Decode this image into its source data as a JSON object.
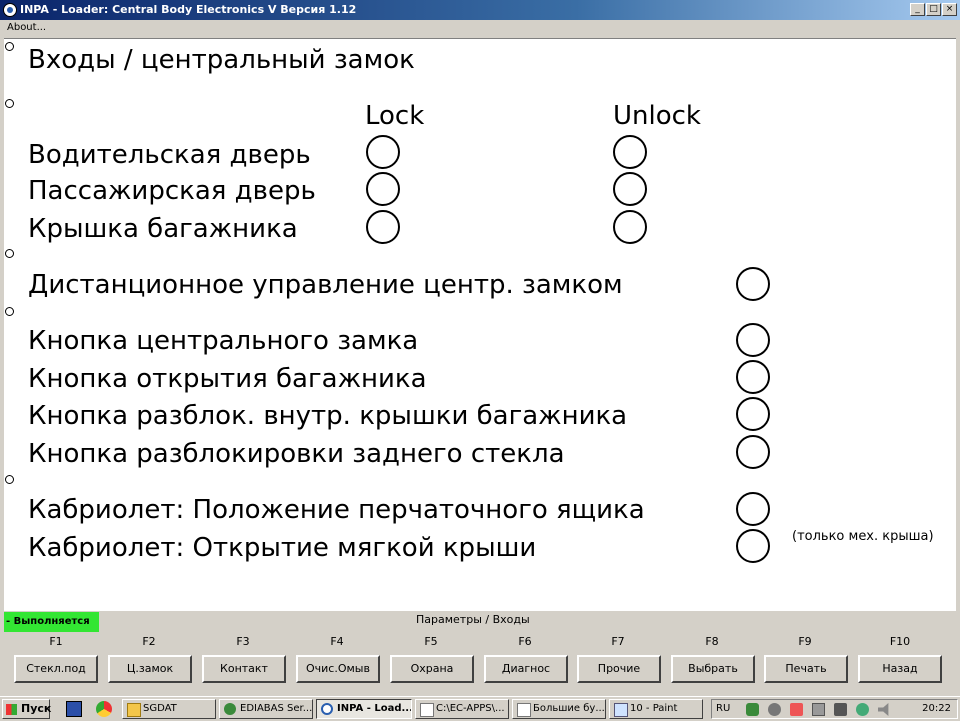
{
  "window": {
    "title": "INPA - Loader:  Central Body Electronics V Версия 1.12",
    "minimize_glyph": "_",
    "maximize_glyph": "□",
    "close_glyph": "×"
  },
  "menu": {
    "about": "About..."
  },
  "screen": {
    "heading": "Входы / центральный замок",
    "col_lock": "Lock",
    "col_unlock": "Unlock",
    "door_rows": [
      "Водительская дверь",
      "Пассажирская дверь",
      "Крышка багажника"
    ],
    "remote": "Дистанционное управление центр. замком",
    "button_rows": [
      "Кнопка центрального замка",
      "Кнопка открытия багажника",
      "Кнопка разблок. внутр. крышки багажника",
      "Кнопка разблокировки заднего стекла"
    ],
    "cabrio_rows": [
      "Кабриолет: Положение перчаточного ящика",
      "Кабриолет: Открытие мягкой крыши"
    ],
    "cabrio_note": "(только мех. крыша)"
  },
  "status": {
    "running": "- Выполняется",
    "screen_name": "Параметры / Входы"
  },
  "fkeys": [
    {
      "key": "F1",
      "label": "Стекл.под"
    },
    {
      "key": "F2",
      "label": "Ц.замок"
    },
    {
      "key": "F3",
      "label": "Контакт"
    },
    {
      "key": "F4",
      "label": "Очис.Омыв"
    },
    {
      "key": "F5",
      "label": "Охрана"
    },
    {
      "key": "F6",
      "label": "Диагнос"
    },
    {
      "key": "F7",
      "label": "Прочие"
    },
    {
      "key": "F8",
      "label": "Выбрать"
    },
    {
      "key": "F9",
      "label": "Печать"
    },
    {
      "key": "F10",
      "label": "Назад"
    }
  ],
  "taskbar": {
    "start": "Пуск",
    "items": [
      "SGDAT",
      "EDIABAS Ser...",
      "INPA - Load...",
      "C:\\EC-APPS\\...",
      "Большие бу...",
      "10 - Paint"
    ],
    "active_index": 2,
    "lang": "RU",
    "clock": "20:22"
  },
  "colors": {
    "running_bg": "#33e633",
    "titlebar": "#0a246a"
  }
}
